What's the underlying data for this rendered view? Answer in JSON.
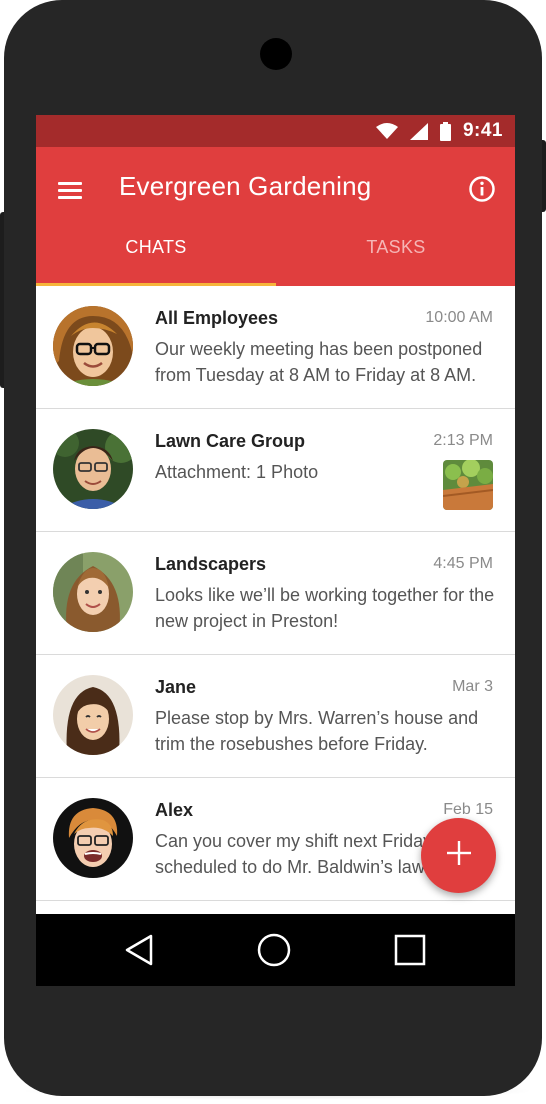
{
  "status_bar": {
    "time": "9:41",
    "wifi_icon": "wifi-icon",
    "signal_icon": "signal-icon",
    "battery_icon": "battery-icon"
  },
  "app_bar": {
    "title": "Evergreen Gardening",
    "menu_icon": "hamburger-menu-icon",
    "info_icon": "info-icon"
  },
  "tabs": [
    {
      "label": "CHATS",
      "selected": true
    },
    {
      "label": "TASKS",
      "selected": false
    }
  ],
  "chats": [
    {
      "name": "All Employees",
      "time": "10:00 AM",
      "message": "Our weekly meeting has been postponed from Tuesday at 8 AM to Friday at 8 AM."
    },
    {
      "name": "Lawn Care Group",
      "time": "2:13 PM",
      "message": "Attachment: 1 Photo"
    },
    {
      "name": "Landscapers",
      "time": "4:45 PM",
      "message": "Looks like we’ll be working together for the new project in Preston!"
    },
    {
      "name": "Jane",
      "time": "Mar 3",
      "message": "Please stop  by Mrs. Warren’s house and trim the rosebushes before Friday."
    },
    {
      "name": "Alex",
      "time": "Feb 15",
      "message": "Can you cover my shift next Friday? I’m scheduled to do Mr. Baldwin’s lawn."
    }
  ],
  "fab": {
    "icon": "plus-icon"
  },
  "nav_bar": {
    "back_icon": "back-icon",
    "home_icon": "home-icon",
    "recents_icon": "recents-icon"
  },
  "colors": {
    "primary": "#e03e3e",
    "primary_dark": "#a42b2b",
    "tab_indicator": "#f6b53b"
  }
}
